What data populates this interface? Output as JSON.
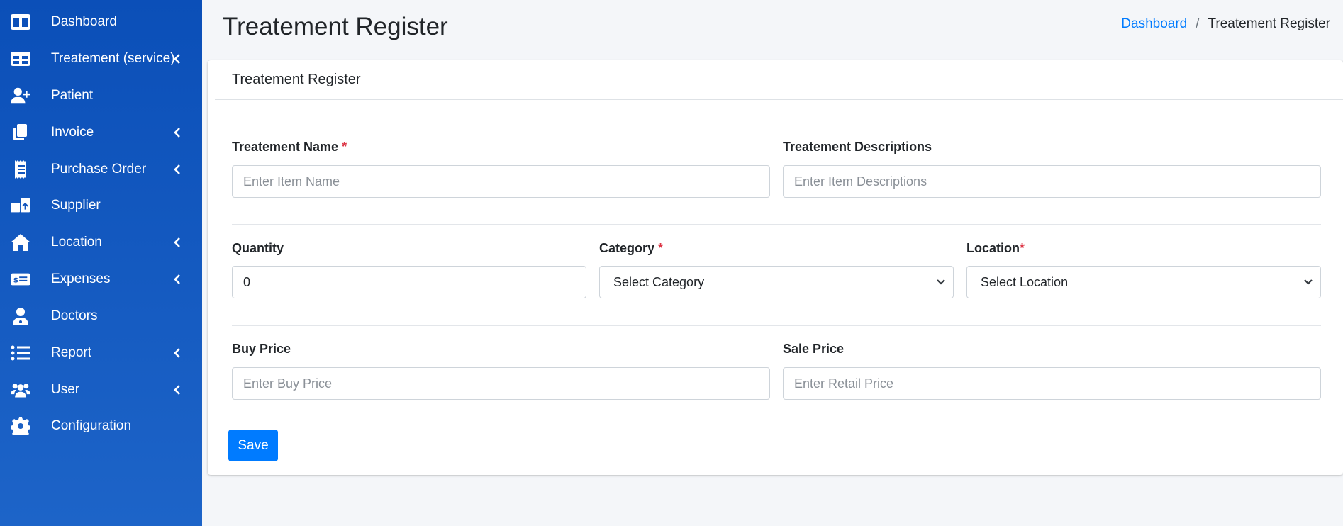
{
  "sidebar": {
    "items": [
      {
        "label": "Dashboard",
        "icon": "columns-icon",
        "has_submenu": false
      },
      {
        "label": "Treatement (service)",
        "icon": "table-icon",
        "has_submenu": true
      },
      {
        "label": "Patient",
        "icon": "user-plus-icon",
        "has_submenu": false
      },
      {
        "label": "Invoice",
        "icon": "copy-icon",
        "has_submenu": true
      },
      {
        "label": "Purchase Order",
        "icon": "receipt-icon",
        "has_submenu": true
      },
      {
        "label": "Supplier",
        "icon": "boxes-icon",
        "has_submenu": false
      },
      {
        "label": "Location",
        "icon": "home-icon",
        "has_submenu": true
      },
      {
        "label": "Expenses",
        "icon": "money-bill-icon",
        "has_submenu": true
      },
      {
        "label": "Doctors",
        "icon": "user-md-icon",
        "has_submenu": false
      },
      {
        "label": "Report",
        "icon": "list-icon",
        "has_submenu": true
      },
      {
        "label": "User",
        "icon": "users-icon",
        "has_submenu": true
      },
      {
        "label": "Configuration",
        "icon": "cog-icon",
        "has_submenu": false
      }
    ]
  },
  "header": {
    "title": "Treatement Register",
    "breadcrumb": {
      "link": "Dashboard",
      "separator": "/",
      "current": "Treatement Register"
    }
  },
  "card": {
    "title": "Treatement Register",
    "fields": {
      "name": {
        "label": "Treatement Name",
        "required_mark": "*",
        "placeholder": "Enter Item Name"
      },
      "descriptions": {
        "label": "Treatement Descriptions",
        "placeholder": "Enter Item Descriptions"
      },
      "quantity": {
        "label": "Quantity",
        "value": "0"
      },
      "category": {
        "label": "Category",
        "required_mark": "*",
        "selected": "Select Category"
      },
      "location": {
        "label": "Location",
        "required_mark": "*",
        "selected": "Select Location"
      },
      "buy_price": {
        "label": "Buy Price",
        "placeholder": "Enter Buy Price"
      },
      "sale_price": {
        "label": "Sale Price",
        "placeholder": "Enter Retail Price"
      }
    },
    "save_label": "Save"
  },
  "colors": {
    "sidebar_top": "#0b4fb8",
    "sidebar_bottom": "#1d64c8",
    "primary": "#007bff",
    "required": "#dc3545",
    "page_bg": "#f4f6f9"
  }
}
